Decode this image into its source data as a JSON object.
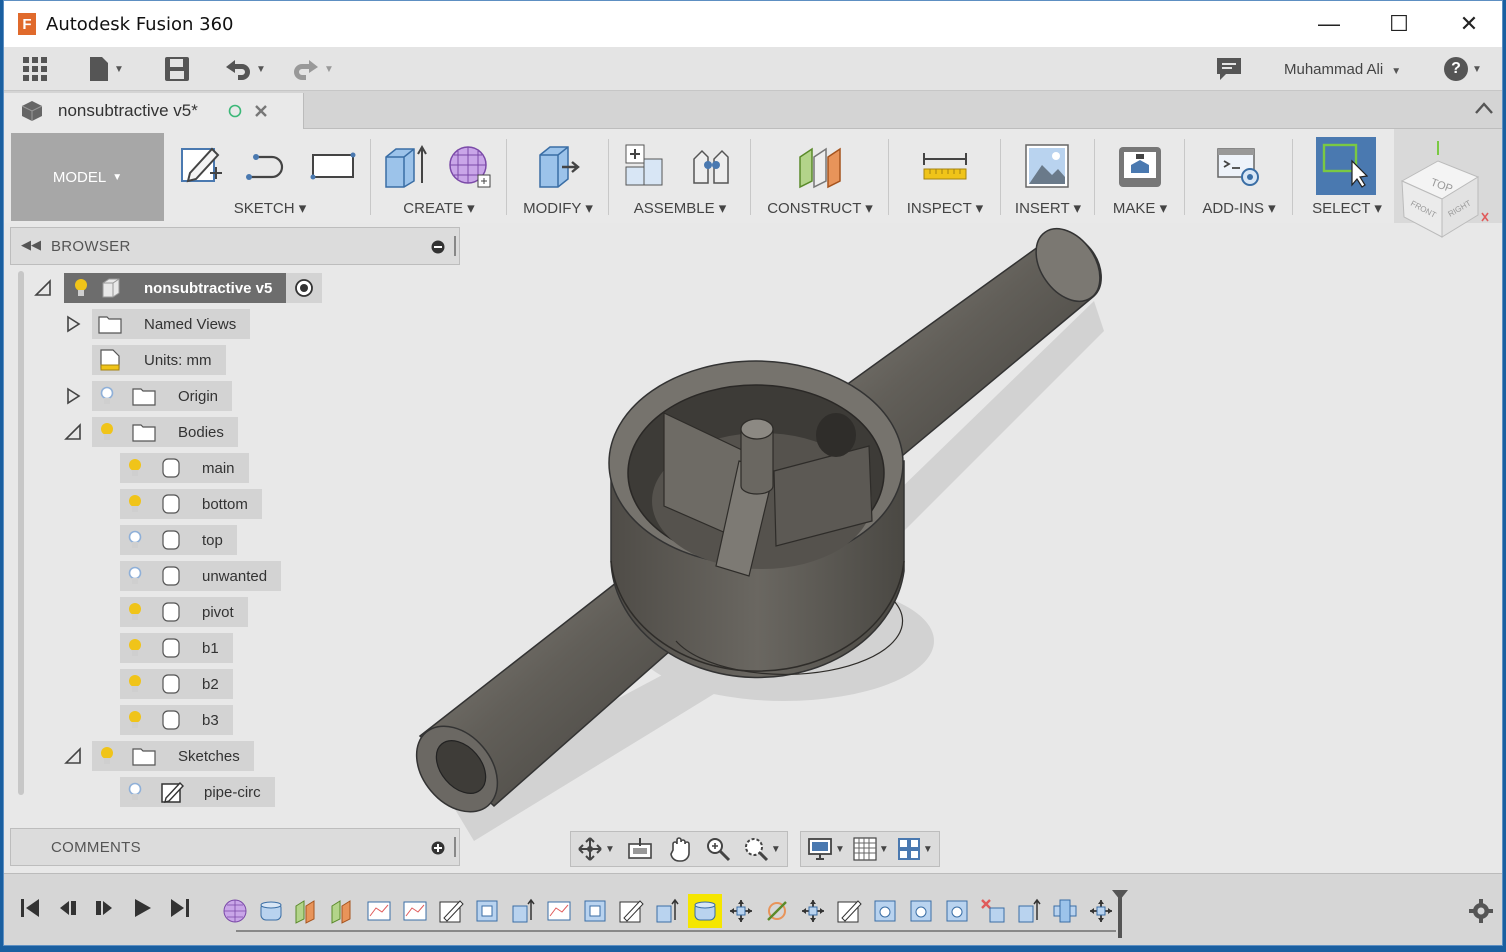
{
  "window": {
    "title": "Autodesk Fusion 360",
    "app_icon_letter": "F"
  },
  "window_controls": {
    "minimize": "—",
    "maximize": "☐",
    "close": "✕"
  },
  "qat": {
    "user": "Muhammad Ali",
    "help": "?"
  },
  "doc_tab": {
    "name": "nonsubtractive v5*"
  },
  "ribbon": {
    "workspace": "MODEL",
    "groups": [
      {
        "label": "SKETCH"
      },
      {
        "label": "CREATE"
      },
      {
        "label": "MODIFY"
      },
      {
        "label": "ASSEMBLE"
      },
      {
        "label": "CONSTRUCT"
      },
      {
        "label": "INSPECT"
      },
      {
        "label": "INSERT"
      },
      {
        "label": "MAKE"
      },
      {
        "label": "ADD-INS"
      },
      {
        "label": "SELECT"
      }
    ]
  },
  "viewcube": {
    "top": "TOP",
    "front": "FRONT",
    "right": "RIGHT"
  },
  "browser": {
    "title": "BROWSER",
    "root": "nonsubtractive v5",
    "items": [
      {
        "label": "Named Views"
      },
      {
        "label": "Units: mm"
      },
      {
        "label": "Origin"
      },
      {
        "label": "Bodies"
      },
      {
        "label": "main"
      },
      {
        "label": "bottom"
      },
      {
        "label": "top"
      },
      {
        "label": "unwanted"
      },
      {
        "label": "pivot"
      },
      {
        "label": "b1"
      },
      {
        "label": "b2"
      },
      {
        "label": "b3"
      },
      {
        "label": "Sketches"
      },
      {
        "label": "pipe-circ"
      }
    ]
  },
  "comments": {
    "title": "COMMENTS"
  },
  "colors": {
    "accent": "#4a79b0",
    "ribbon_bg": "#e9e9e9",
    "model_gray": "#5f5c57",
    "bulb_on": "#f0c419",
    "bulb_off": "#8fb0d8"
  }
}
